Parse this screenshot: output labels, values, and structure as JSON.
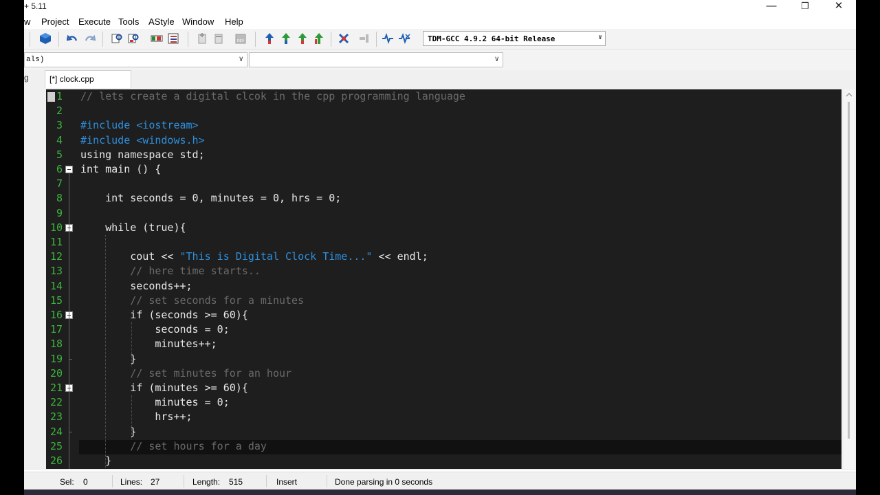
{
  "window": {
    "title": "+ 5.11",
    "minimize_glyph": "—",
    "restore_glyph": "❐",
    "close_glyph": "✕"
  },
  "menu": [
    "w",
    "Project",
    "Execute",
    "Tools",
    "AStyle",
    "Window",
    "Help"
  ],
  "toolbar": {
    "compiler": "TDM-GCC 4.9.2 64-bit Release"
  },
  "class_browser": {
    "left_combo": "als)",
    "right_combo": ""
  },
  "tabs": {
    "side_label": "g",
    "file_tab": "[*] clock.cpp"
  },
  "editor": {
    "line_numbers": [
      "1",
      "2",
      "3",
      "4",
      "5",
      "6",
      "7",
      "8",
      "9",
      "10",
      "11",
      "12",
      "13",
      "14",
      "15",
      "16",
      "17",
      "18",
      "19",
      "20",
      "21",
      "22",
      "23",
      "24",
      "25",
      "26"
    ],
    "lines": [
      {
        "segments": [
          {
            "t": "// lets create a digital clcok in the cpp programming language",
            "c": "comment"
          }
        ]
      },
      {
        "segments": []
      },
      {
        "segments": [
          {
            "t": "#include <iostream>",
            "c": "pre"
          }
        ]
      },
      {
        "segments": [
          {
            "t": "#include <windows.h>",
            "c": "pre"
          }
        ]
      },
      {
        "segments": [
          {
            "t": "using namespace std;",
            "c": "kw"
          }
        ]
      },
      {
        "segments": [
          {
            "t": "int main () {",
            "c": "kw"
          }
        ]
      },
      {
        "segments": []
      },
      {
        "segments": [
          {
            "t": "    int seconds = 0, minutes = 0, hrs = 0;",
            "c": "kw"
          }
        ]
      },
      {
        "segments": []
      },
      {
        "segments": [
          {
            "t": "    while (true){",
            "c": "kw"
          }
        ]
      },
      {
        "segments": []
      },
      {
        "segments": [
          {
            "t": "        cout << ",
            "c": "kw"
          },
          {
            "t": "\"This is Digital Clock Time...\"",
            "c": "str"
          },
          {
            "t": " << endl;",
            "c": "kw"
          }
        ]
      },
      {
        "segments": [
          {
            "t": "        // here time starts..",
            "c": "comment"
          }
        ]
      },
      {
        "segments": [
          {
            "t": "        seconds++;",
            "c": "kw"
          }
        ]
      },
      {
        "segments": [
          {
            "t": "        // set seconds for a minutes",
            "c": "comment"
          }
        ]
      },
      {
        "segments": [
          {
            "t": "        if (seconds >= 60){",
            "c": "kw"
          }
        ]
      },
      {
        "segments": [
          {
            "t": "            seconds = 0;",
            "c": "kw"
          }
        ]
      },
      {
        "segments": [
          {
            "t": "            minutes++;",
            "c": "kw"
          }
        ]
      },
      {
        "segments": [
          {
            "t": "        }",
            "c": "kw"
          }
        ]
      },
      {
        "segments": [
          {
            "t": "        // set minutes for an hour",
            "c": "comment"
          }
        ]
      },
      {
        "segments": [
          {
            "t": "        if (minutes >= 60){",
            "c": "kw"
          }
        ]
      },
      {
        "segments": [
          {
            "t": "            minutes = 0;",
            "c": "kw"
          }
        ]
      },
      {
        "segments": [
          {
            "t": "            hrs++;",
            "c": "kw"
          }
        ]
      },
      {
        "segments": [
          {
            "t": "        }",
            "c": "kw"
          }
        ]
      },
      {
        "segments": [
          {
            "t": "        // set hours for a day",
            "c": "comment"
          }
        ]
      },
      {
        "segments": [
          {
            "t": "    }",
            "c": "kw"
          }
        ]
      }
    ]
  },
  "status": {
    "sel_label": "Sel:",
    "sel_value": "0",
    "lines_label": "Lines:",
    "lines_value": "27",
    "length_label": "Length:",
    "length_value": "515",
    "mode": "Insert",
    "message": "Done parsing in 0 seconds"
  }
}
